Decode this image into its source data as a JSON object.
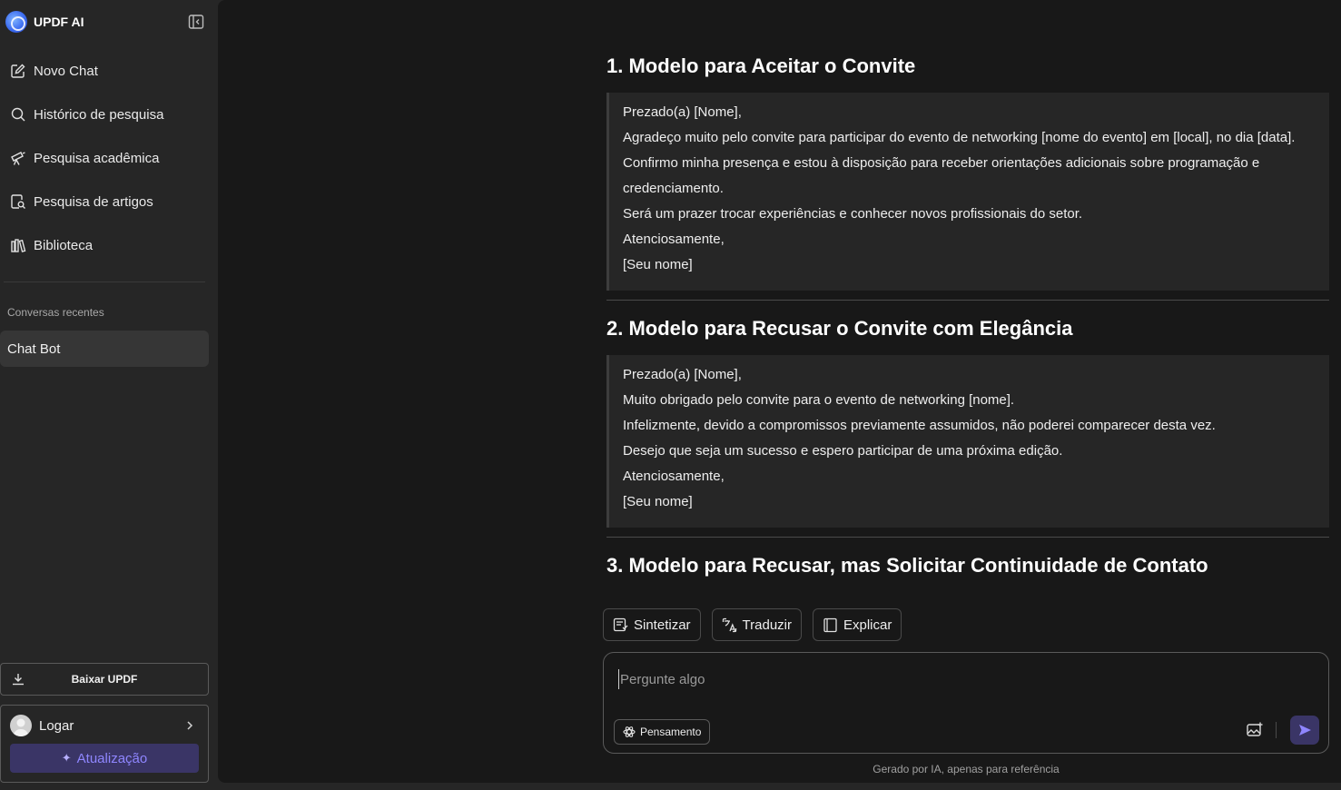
{
  "brand": {
    "name": "UPDF AI"
  },
  "sidebar": {
    "nav": [
      {
        "label": "Novo Chat",
        "icon": "edit-icon"
      },
      {
        "label": "Histórico de pesquisa",
        "icon": "search-icon"
      },
      {
        "label": "Pesquisa acadêmica",
        "icon": "telescope-icon"
      },
      {
        "label": "Pesquisa de artigos",
        "icon": "document-search-icon"
      },
      {
        "label": "Biblioteca",
        "icon": "library-icon"
      }
    ],
    "recent_label": "Conversas recentes",
    "recent_items": [
      {
        "label": "Chat Bot"
      }
    ],
    "download_label": "Baixar UPDF",
    "login_label": "Logar",
    "upgrade_label": "Atualização"
  },
  "content": {
    "sections": [
      {
        "title": "1. Modelo para Aceitar o Convite",
        "lines": [
          "Prezado(a) [Nome],",
          "Agradeço muito pelo convite para participar do evento de networking [nome do evento] em [local], no dia [data].",
          "Confirmo minha presença e estou à disposição para receber orientações adicionais sobre programação e credenciamento.",
          "Será um prazer trocar experiências e conhecer novos profissionais do setor.",
          "Atenciosamente,",
          "[Seu nome]"
        ]
      },
      {
        "title": "2. Modelo para Recusar o Convite com Elegância",
        "lines": [
          "Prezado(a) [Nome],",
          "Muito obrigado pelo convite para o evento de networking [nome].",
          "Infelizmente, devido a compromissos previamente assumidos, não poderei comparecer desta vez.",
          "Desejo que seja um sucesso e espero participar de uma próxima edição.",
          "Atenciosamente,",
          "[Seu nome]"
        ]
      },
      {
        "title": "3. Modelo para Recusar, mas Solicitar Continuidade de Contato",
        "lines": []
      }
    ]
  },
  "actions": [
    {
      "label": "Sintetizar",
      "icon": "summarize-icon"
    },
    {
      "label": "Traduzir",
      "icon": "translate-icon"
    },
    {
      "label": "Explicar",
      "icon": "book-icon"
    }
  ],
  "composer": {
    "placeholder": "Pergunte algo",
    "value": "",
    "thinking_label": "Pensamento"
  },
  "footer_note": "Gerado por IA, apenas para referência",
  "colors": {
    "accent": "#3a3566",
    "accent_text": "#8f86ff",
    "background": "#181818",
    "sidebar": "#262626"
  }
}
